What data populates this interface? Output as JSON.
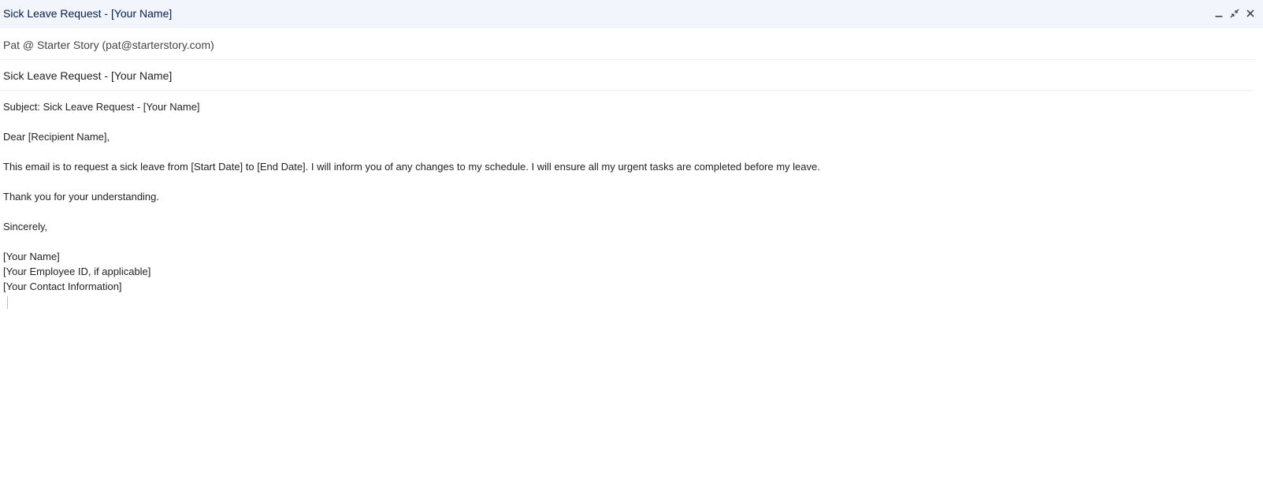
{
  "compose": {
    "title": "Sick Leave Request - [Your Name]",
    "controls": {
      "minimize_icon": "minimize-icon",
      "exit_fullscreen_icon": "exit-fullscreen-icon",
      "close_icon": "close-icon"
    },
    "from": "Pat @ Starter Story (pat@starterstory.com)",
    "subject": "Sick Leave Request - [Your Name]"
  },
  "body": {
    "subject_line": "Subject: Sick Leave Request - [Your Name]",
    "greeting": "Dear [Recipient Name],",
    "paragraph": "This email is to request a sick leave from [Start Date] to [End Date]. I will inform you of any changes to my schedule. I will ensure all my urgent tasks are completed before my leave.",
    "thanks": "Thank you for your understanding.",
    "closing": "Sincerely,",
    "signature": {
      "name": "[Your Name]",
      "employee_id": "[Your Employee ID, if applicable]",
      "contact": "[Your Contact Information]"
    }
  },
  "colors": {
    "titlebar_bg": "#f2f6fc",
    "title_text": "#041e49"
  }
}
